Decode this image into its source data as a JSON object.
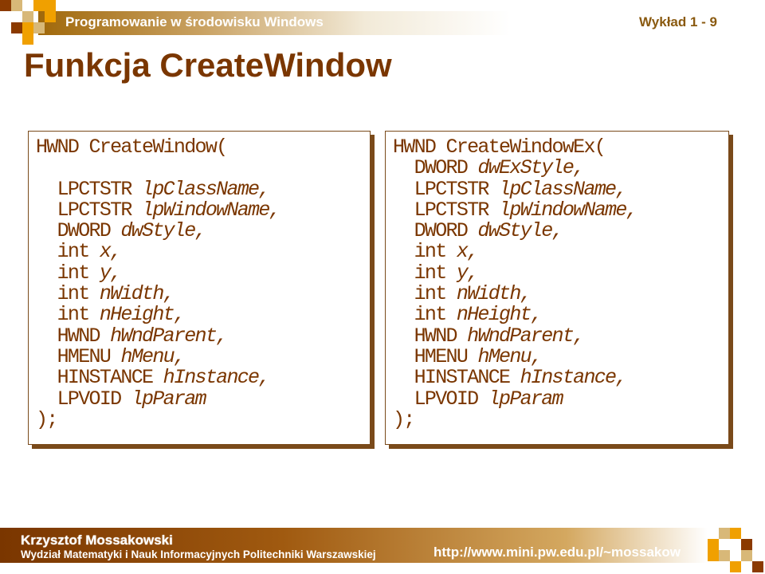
{
  "header": {
    "course_title": "Programowanie w środowisku Windows",
    "lecture_number": "Wykład 1 - 9"
  },
  "slide": {
    "title": "Funkcja CreateWindow"
  },
  "code_left": {
    "lines": [
      {
        "indent": "",
        "kw": "HWND CreateWindow(",
        "param": ""
      },
      {
        "indent": "",
        "kw": "",
        "param": ""
      },
      {
        "indent": "  ",
        "kw": "LPCTSTR ",
        "param": "lpClassName,"
      },
      {
        "indent": "  ",
        "kw": "LPCTSTR ",
        "param": "lpWindowName,"
      },
      {
        "indent": "  ",
        "kw": "DWORD ",
        "param": "dwStyle,"
      },
      {
        "indent": "  ",
        "kw": "int ",
        "param": "x,"
      },
      {
        "indent": "  ",
        "kw": "int ",
        "param": "y,"
      },
      {
        "indent": "  ",
        "kw": "int ",
        "param": "nWidth,"
      },
      {
        "indent": "  ",
        "kw": "int ",
        "param": "nHeight,"
      },
      {
        "indent": "  ",
        "kw": "HWND ",
        "param": "hWndParent,"
      },
      {
        "indent": "  ",
        "kw": "HMENU ",
        "param": "hMenu,"
      },
      {
        "indent": "  ",
        "kw": "HINSTANCE ",
        "param": "hInstance,"
      },
      {
        "indent": "  ",
        "kw": "LPVOID ",
        "param": "lpParam"
      },
      {
        "indent": "",
        "kw": ");",
        "param": ""
      }
    ]
  },
  "code_right": {
    "lines": [
      {
        "indent": "",
        "kw": "HWND CreateWindowEx(",
        "param": ""
      },
      {
        "indent": "  ",
        "kw": "DWORD ",
        "param": "dwExStyle,"
      },
      {
        "indent": "  ",
        "kw": "LPCTSTR ",
        "param": "lpClassName,"
      },
      {
        "indent": "  ",
        "kw": "LPCTSTR ",
        "param": "lpWindowName,"
      },
      {
        "indent": "  ",
        "kw": "DWORD ",
        "param": "dwStyle,"
      },
      {
        "indent": "  ",
        "kw": "int ",
        "param": "x,"
      },
      {
        "indent": "  ",
        "kw": "int ",
        "param": "y,"
      },
      {
        "indent": "  ",
        "kw": "int ",
        "param": "nWidth,"
      },
      {
        "indent": "  ",
        "kw": "int ",
        "param": "nHeight,"
      },
      {
        "indent": "  ",
        "kw": "HWND ",
        "param": "hWndParent,"
      },
      {
        "indent": "  ",
        "kw": "HMENU ",
        "param": "hMenu,"
      },
      {
        "indent": "  ",
        "kw": "HINSTANCE ",
        "param": "hInstance,"
      },
      {
        "indent": "  ",
        "kw": "LPVOID ",
        "param": "lpParam"
      },
      {
        "indent": "",
        "kw": ");",
        "param": ""
      }
    ]
  },
  "footer": {
    "author": "Krzysztof Mossakowski",
    "department": "Wydział Matematyki i Nauk Informacyjnych Politechniki Warszawskiej",
    "url": "http://www.mini.pw.edu.pl/~mossakow"
  },
  "colors": {
    "brand_dark": "#7a3600",
    "accent_orange": "#f0a000",
    "box_border": "#7a4a1a"
  }
}
